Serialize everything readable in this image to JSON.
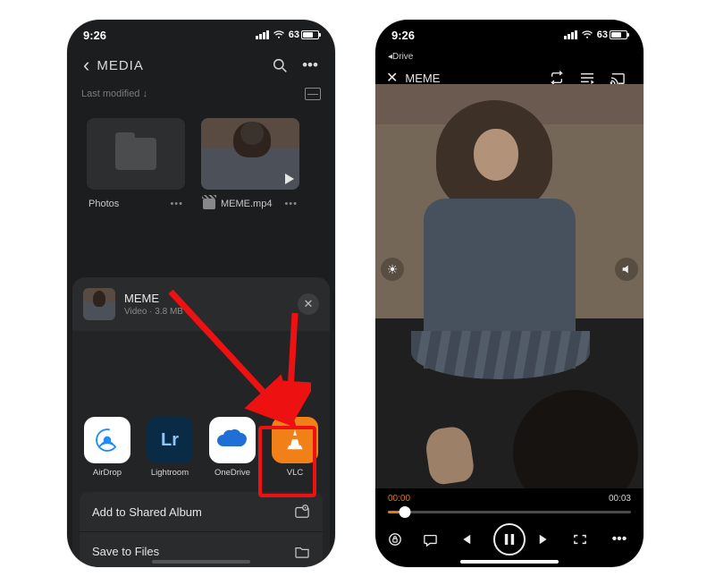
{
  "status": {
    "time": "9:26",
    "battery": "63"
  },
  "left": {
    "title": "MEDIA",
    "sort": "Last modified ↓",
    "files": {
      "folder": "Photos",
      "video": "MEME.mp4"
    },
    "share": {
      "name": "MEME",
      "meta": "Video · 3.8 MB"
    },
    "apps": {
      "airdrop": "AirDrop",
      "lightroom": "Lightroom",
      "onedrive": "OneDrive",
      "vlc": "VLC",
      "lr_text": "Lr"
    },
    "actions": {
      "shared_album": "Add to Shared Album",
      "save_files": "Save to Files"
    }
  },
  "right": {
    "source": "◂Drive",
    "title": "MEME",
    "time_cur": "00:00",
    "time_dur": "00:03"
  }
}
